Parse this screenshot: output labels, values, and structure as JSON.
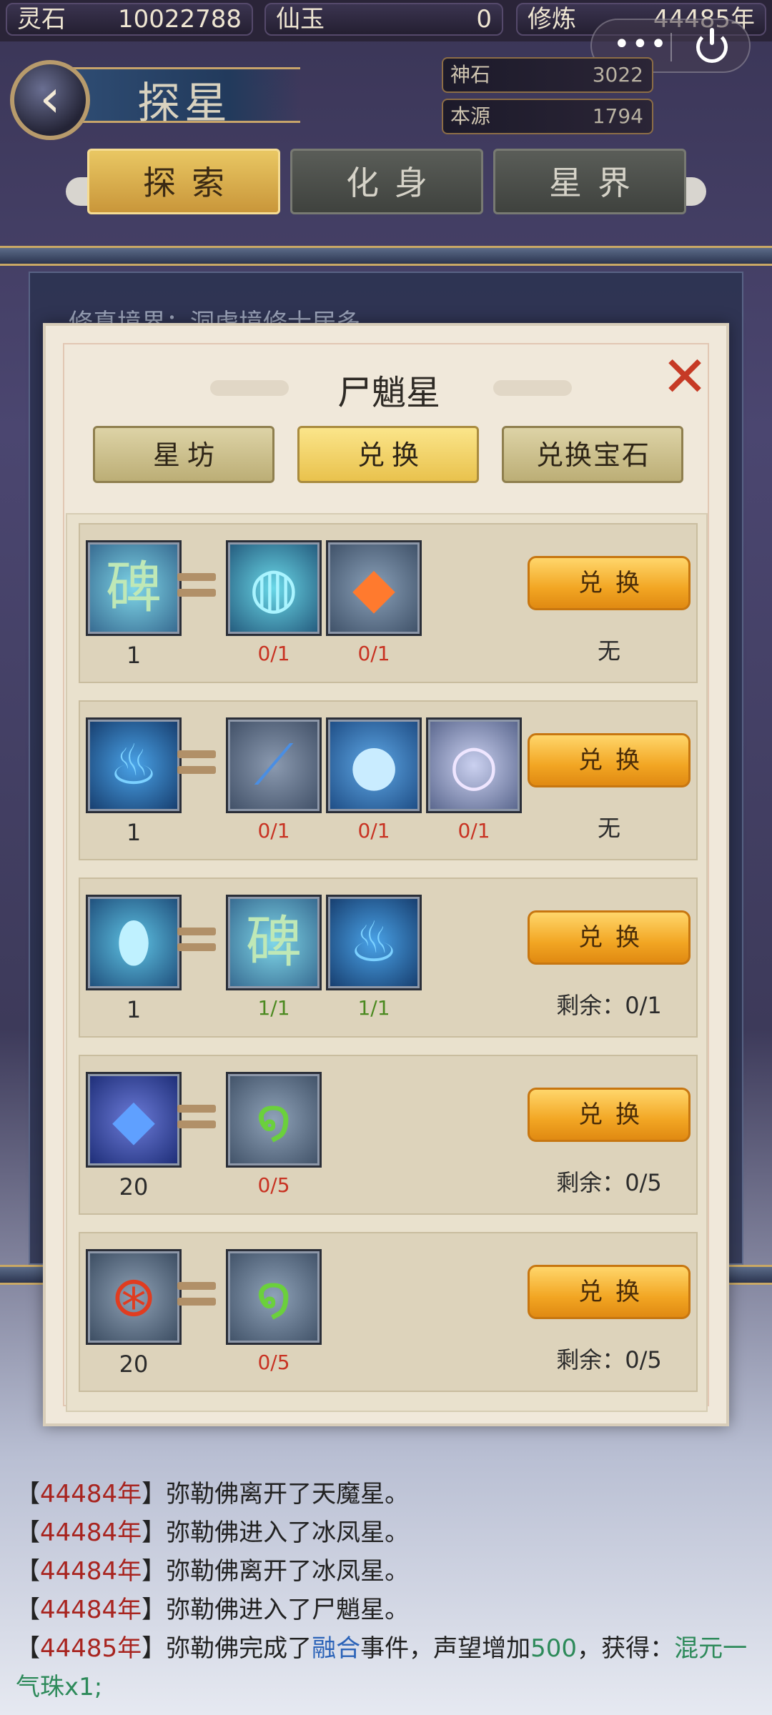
{
  "resources": [
    {
      "label": "灵石",
      "value": "10022788"
    },
    {
      "label": "仙玉",
      "value": "0"
    },
    {
      "label": "修炼",
      "value": "44485年"
    }
  ],
  "header": {
    "title": "探星",
    "back_glyph": "‹",
    "stats": [
      {
        "label": "神石",
        "value": "3022"
      },
      {
        "label": "本源",
        "value": "1794"
      }
    ],
    "tabs": [
      {
        "label": "探索",
        "active": true
      },
      {
        "label": "化身",
        "active": false
      },
      {
        "label": "星界",
        "active": false
      }
    ]
  },
  "miniprogram": {
    "more": "•••"
  },
  "underlay_text": "修真境界：洞虚境修士居多",
  "modal": {
    "title": "尸魈星",
    "close": "✕",
    "tabs": [
      {
        "label": "星坊",
        "active": false
      },
      {
        "label": "兑换",
        "active": true
      },
      {
        "label": "兑换宝石",
        "active": false
      }
    ],
    "exchange_label": "兑换",
    "rows": [
      {
        "target": {
          "icon": "stone-stele-icon",
          "qty": "1"
        },
        "costs": [
          {
            "icon": "spirit-orb-icon",
            "progress": "0/1",
            "color": "#c83222"
          },
          {
            "icon": "fire-crystal-icon",
            "progress": "0/1",
            "color": "#c83222"
          }
        ],
        "remain": "无"
      },
      {
        "target": {
          "icon": "blue-flame-icon",
          "qty": "1"
        },
        "costs": [
          {
            "icon": "blade-shard-icon",
            "progress": "0/1",
            "color": "#c83222"
          },
          {
            "icon": "wave-orb-icon",
            "progress": "0/1",
            "color": "#c83222"
          },
          {
            "icon": "pearl-orb-icon",
            "progress": "0/1",
            "color": "#c83222"
          }
        ],
        "remain": "无"
      },
      {
        "target": {
          "icon": "spirit-egg-icon",
          "qty": "1"
        },
        "costs": [
          {
            "icon": "stone-stele-icon",
            "progress": "1/1",
            "color": "#4b8a20"
          },
          {
            "icon": "blue-flame-icon",
            "progress": "1/1",
            "color": "#4b8a20"
          }
        ],
        "remain": "剩余：0/1"
      },
      {
        "target": {
          "icon": "blue-gem-icon",
          "qty": "20"
        },
        "costs": [
          {
            "icon": "jade-dragon-icon",
            "progress": "0/5",
            "color": "#c83222"
          }
        ],
        "remain": "剩余：0/5"
      },
      {
        "target": {
          "icon": "caged-orb-icon",
          "qty": "20"
        },
        "costs": [
          {
            "icon": "jade-dragon-icon",
            "progress": "0/5",
            "color": "#c83222"
          }
        ],
        "remain": "剩余：0/5"
      }
    ]
  },
  "chat": [
    {
      "year": "44484年",
      "text": "弥勒佛离开了天魔星。"
    },
    {
      "year": "44484年",
      "text": "弥勒佛进入了冰凤星。"
    },
    {
      "year": "44484年",
      "text": "弥勒佛离开了冰凤星。"
    },
    {
      "year": "44484年",
      "text": "弥勒佛进入了尸魈星。"
    },
    {
      "year": "44485年",
      "text_a": "弥勒佛完成了",
      "hl1": "融合",
      "text_b": "事件，声望增加",
      "hl2": "500",
      "text_c": "，获得：",
      "hl3": "混元一气珠x1;"
    }
  ],
  "colors": {
    "accent_gold": "#e9c763",
    "alert_red": "#c83222",
    "ok_green": "#4b8a20",
    "year_red": "#a8241f"
  }
}
